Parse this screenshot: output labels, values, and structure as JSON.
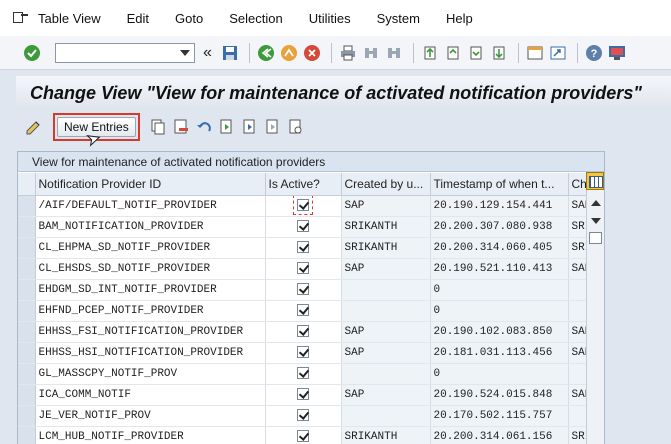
{
  "menubar": {
    "items": [
      "Table View",
      "Edit",
      "Goto",
      "Selection",
      "Utilities",
      "System",
      "Help"
    ]
  },
  "toolbar": {
    "command_value": "",
    "back_chevrons": "«"
  },
  "title": "Change View \"View for maintenance of activated notification providers\"",
  "apptool": {
    "new_entries_label": "New Entries"
  },
  "table": {
    "caption": "View for maintenance of activated notification providers",
    "columns": [
      "Notification Provider ID",
      "Is Active?",
      "Created by u...",
      "Timestamp of when t...",
      "Cha"
    ],
    "rows": [
      {
        "id": "/AIF/DEFAULT_NOTIF_PROVIDER",
        "active": true,
        "created_by": "SAP",
        "timestamp": "20.190.129.154.441",
        "changed": "SAP"
      },
      {
        "id": "BAM_NOTIFICATION_PROVIDER",
        "active": true,
        "created_by": "SRIKANTH",
        "timestamp": "20.200.307.080.938",
        "changed": "SRI"
      },
      {
        "id": "CL_EHPMA_SD_NOTIF_PROVIDER",
        "active": true,
        "created_by": "SRIKANTH",
        "timestamp": "20.200.314.060.405",
        "changed": "SRI"
      },
      {
        "id": "CL_EHSDS_SD_NOTIF_PROVIDER",
        "active": true,
        "created_by": "SAP",
        "timestamp": "20.190.521.110.413",
        "changed": "SAP"
      },
      {
        "id": "EHDGM_SD_INT_NOTIF_PROVIDER",
        "active": true,
        "created_by": "",
        "timestamp": "0",
        "changed": ""
      },
      {
        "id": "EHFND_PCEP_NOTIF_PROVIDER",
        "active": true,
        "created_by": "",
        "timestamp": "0",
        "changed": ""
      },
      {
        "id": "EHHSS_FSI_NOTIFICATION_PROVIDER",
        "active": true,
        "created_by": "SAP",
        "timestamp": "20.190.102.083.850",
        "changed": "SAP"
      },
      {
        "id": "EHHSS_HSI_NOTIFICATION_PROVIDER",
        "active": true,
        "created_by": "SAP",
        "timestamp": "20.181.031.113.456",
        "changed": "SAP"
      },
      {
        "id": "GL_MASSCPY_NOTIF_PROV",
        "active": true,
        "created_by": "",
        "timestamp": "0",
        "changed": ""
      },
      {
        "id": "ICA_COMM_NOTIF",
        "active": true,
        "created_by": "SAP",
        "timestamp": "20.190.524.015.848",
        "changed": "SAP"
      },
      {
        "id": "JE_VER_NOTIF_PROV",
        "active": true,
        "created_by": "",
        "timestamp": "20.170.502.115.757",
        "changed": ""
      },
      {
        "id": "LCM_HUB_NOTIF_PROVIDER",
        "active": true,
        "created_by": "SRIKANTH",
        "timestamp": "20.200.314.061.156",
        "changed": "SRI"
      }
    ]
  },
  "colors": {
    "accent_red": "#d9382c",
    "header_bg": "#e8eef5",
    "caption_bg": "#d9e4f0"
  }
}
